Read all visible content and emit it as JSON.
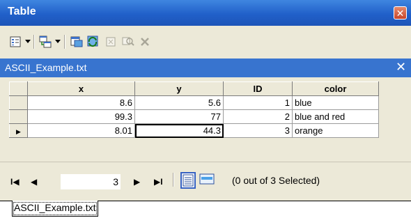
{
  "window": {
    "title": "Table",
    "close_glyph": "✕"
  },
  "toolbar": {
    "buttons": [
      {
        "icon": "table-options-icon",
        "has_dropdown": true
      },
      {
        "icon": "related-tables-icon",
        "has_dropdown": true
      },
      {
        "icon": "select-by-attributes-icon"
      },
      {
        "icon": "switch-selection-icon"
      },
      {
        "icon": "clear-selection-icon"
      },
      {
        "icon": "zoom-to-selected-icon"
      },
      {
        "icon": "delete-selected-icon"
      }
    ]
  },
  "tab": {
    "title": "ASCII_Example.txt",
    "close_glyph": "✕"
  },
  "grid": {
    "columns": [
      "x",
      "y",
      "ID",
      "color"
    ],
    "rows": [
      {
        "x": "8.6",
        "y": "5.6",
        "ID": "1",
        "color": "blue",
        "current": false
      },
      {
        "x": "99.3",
        "y": "77",
        "ID": "2",
        "color": "blue and red",
        "current": false
      },
      {
        "x": "8.01",
        "y": "44.3",
        "ID": "3",
        "color": "orange",
        "current": true
      }
    ],
    "row_indicator_glyph": "▶"
  },
  "navigation": {
    "first_glyph": "I◀",
    "prev_glyph": "◀",
    "current_record": "3",
    "next_glyph": "▶",
    "last_glyph": "▶I",
    "status": "(0 out of 3 Selected)"
  },
  "bottom_tab": {
    "label": "ASCII_Example.txt"
  }
}
